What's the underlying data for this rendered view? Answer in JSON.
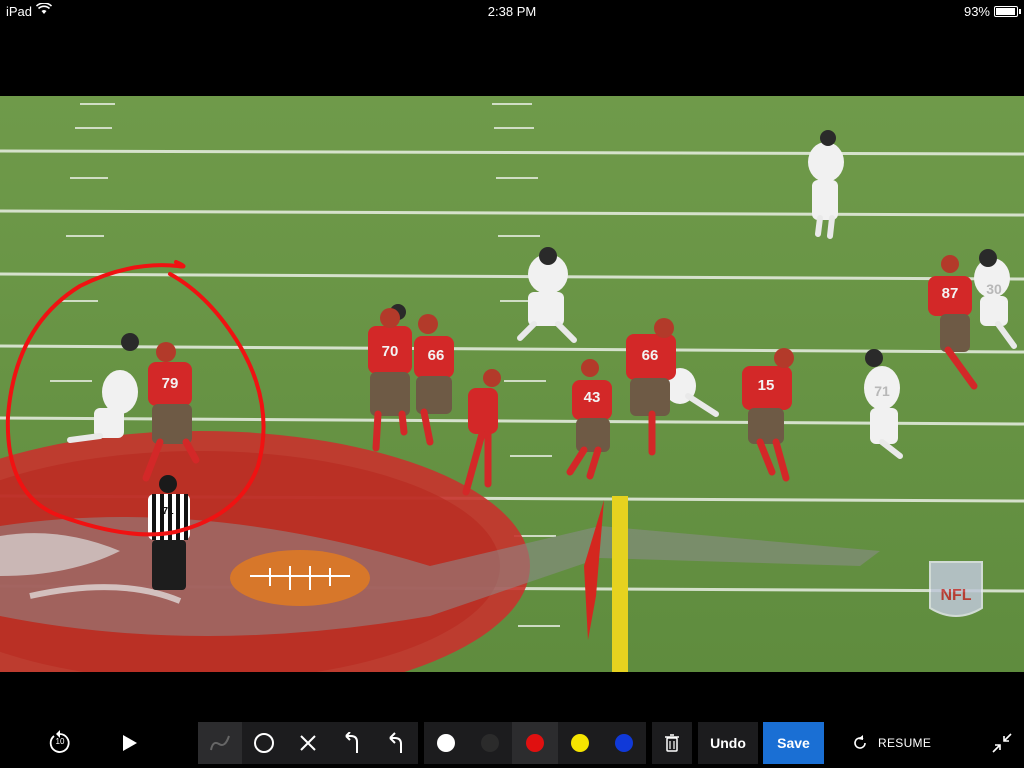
{
  "status_bar": {
    "device": "iPad",
    "time": "2:38 PM",
    "battery": "93%",
    "battery_level": 0.93
  },
  "video": {
    "player_numbers": [
      "79",
      "70",
      "66",
      "43",
      "66",
      "15",
      "87",
      "30",
      "71"
    ],
    "referee_number": "71",
    "watermark": "NFL"
  },
  "toolbar": {
    "rewind_label": "10",
    "undo_label": "Undo",
    "save_label": "Save",
    "resume_label": "RESUME",
    "colors": {
      "white": "#ffffff",
      "black": "#2b2b2b",
      "red": "#e01010",
      "yellow": "#f5e400",
      "blue": "#1039d8",
      "save_bg": "#1a6fd4"
    }
  }
}
